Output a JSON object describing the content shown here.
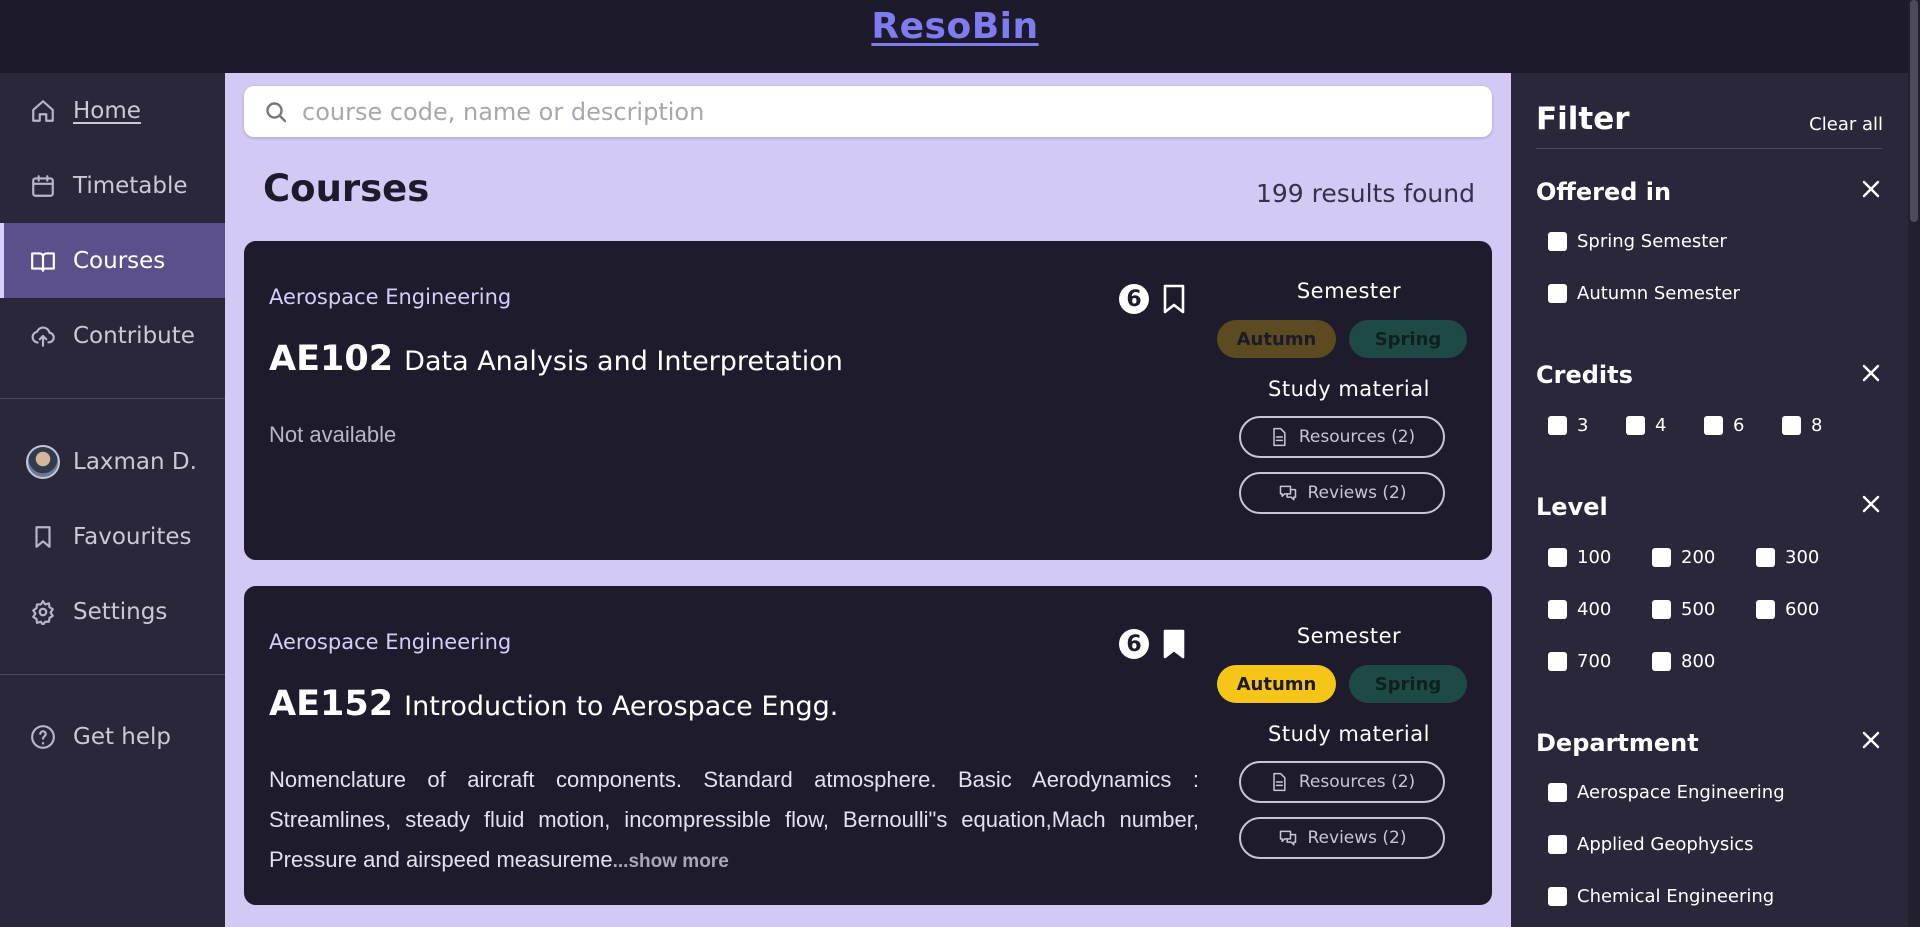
{
  "app": {
    "title": "ResoBin"
  },
  "nav": {
    "home": "Home",
    "timetable": "Timetable",
    "courses": "Courses",
    "contribute": "Contribute",
    "user": "Laxman D.",
    "favourites": "Favourites",
    "settings": "Settings",
    "help": "Get help"
  },
  "search": {
    "placeholder": "course code, name or description",
    "value": ""
  },
  "main": {
    "title": "Courses",
    "results": "199 results found"
  },
  "courses": [
    {
      "department": "Aerospace Engineering",
      "code": "AE102",
      "name": "Data Analysis and Interpretation",
      "description": "Not available",
      "favourites": "6",
      "bookmarked": false,
      "semester_label": "Semester",
      "autumn": "Autumn",
      "spring": "Spring",
      "autumn_active": false,
      "spring_active": false,
      "study_label": "Study material",
      "resources": "Resources (2)",
      "reviews": "Reviews (2)"
    },
    {
      "department": "Aerospace Engineering",
      "code": "AE152",
      "name": "Introduction to Aerospace Engg.",
      "description": "Nomenclature of aircraft components. Standard atmosphere. Basic Aerodynamics : Streamlines, steady fluid motion, incompressible flow, Bernoulli\"s equation,Mach number, Pressure and airspeed measureme",
      "show_more": "...show more",
      "favourites": "6",
      "bookmarked": true,
      "semester_label": "Semester",
      "autumn": "Autumn",
      "spring": "Spring",
      "autumn_active": true,
      "spring_active": false,
      "study_label": "Study material",
      "resources": "Resources (2)",
      "reviews": "Reviews (2)"
    }
  ],
  "filter": {
    "title": "Filter",
    "clear": "Clear all",
    "offered": {
      "title": "Offered in",
      "options": [
        "Spring Semester",
        "Autumn Semester"
      ]
    },
    "credits": {
      "title": "Credits",
      "options": [
        "3",
        "4",
        "6",
        "8"
      ]
    },
    "level": {
      "title": "Level",
      "options": [
        "100",
        "200",
        "300",
        "400",
        "500",
        "600",
        "700",
        "800"
      ]
    },
    "department": {
      "title": "Department",
      "options": [
        "Aerospace Engineering",
        "Applied Geophysics",
        "Chemical Engineering"
      ]
    }
  },
  "colors": {
    "accent": "#7d7cf0",
    "autumn": "#f5c518",
    "spring": "#1e4a45",
    "background": "#d4c8f4"
  }
}
